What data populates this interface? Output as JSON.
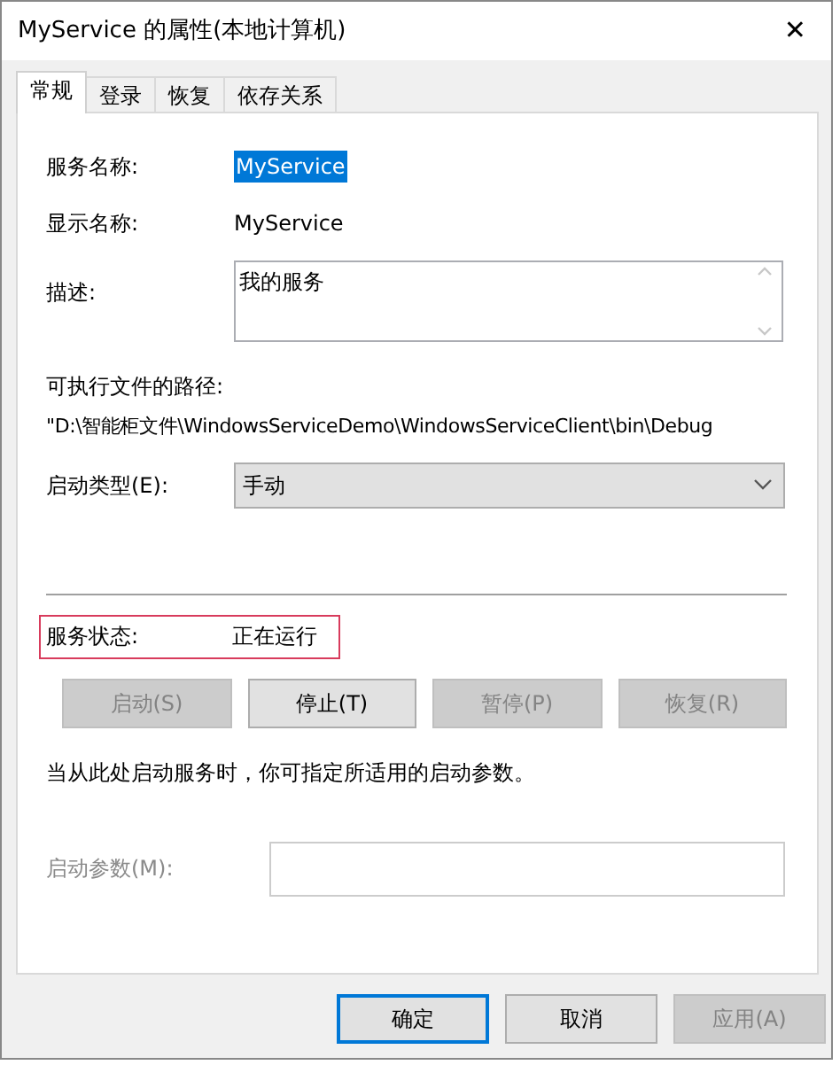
{
  "window": {
    "title": "MyService 的属性(本地计算机)",
    "close": "✕"
  },
  "tabs": [
    {
      "label": "常规",
      "selected": true
    },
    {
      "label": "登录",
      "selected": false
    },
    {
      "label": "恢复",
      "selected": false
    },
    {
      "label": "依存关系",
      "selected": false
    }
  ],
  "service_name": {
    "label": "服务名称:",
    "value": "MyService",
    "selected": true
  },
  "display_name": {
    "label": "显示名称:",
    "value": "MyService"
  },
  "description": {
    "label": "描述:",
    "value": "我的服务"
  },
  "path": {
    "label": "可执行文件的路径:",
    "value": "\"D:\\智能柜文件\\WindowsServiceDemo\\WindowsServiceClient\\bin\\Debug"
  },
  "startup_type": {
    "label": "启动类型(E):",
    "value": "手动"
  },
  "status": {
    "label": "服务状态:",
    "value": "正在运行",
    "highlighted": true
  },
  "service_buttons": [
    {
      "label": "启动(S)",
      "disabled": true
    },
    {
      "label": "停止(T)",
      "disabled": false
    },
    {
      "label": "暂停(P)",
      "disabled": true
    },
    {
      "label": "恢复(R)",
      "disabled": true
    }
  ],
  "hint": "当从此处启动服务时，你可指定所适用的启动参数。",
  "start_params": {
    "label": "启动参数(M):",
    "disabled": true
  },
  "dialog_buttons": [
    {
      "label": "确定",
      "default": true,
      "disabled": false
    },
    {
      "label": "取消",
      "default": false,
      "disabled": false
    },
    {
      "label": "应用(A)",
      "default": false,
      "disabled": true
    }
  ]
}
